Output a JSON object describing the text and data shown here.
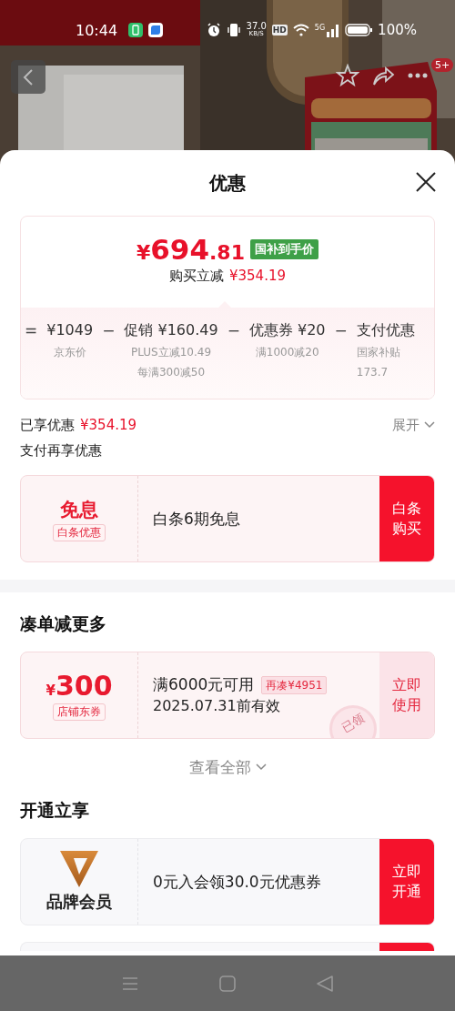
{
  "status_bar": {
    "time": "10:44",
    "net_speed": "37.0",
    "net_unit": "KB/S",
    "hd": "HD",
    "network": "5G",
    "battery": "100%"
  },
  "header": {
    "kind": "picture",
    "badge": "5+"
  },
  "sheet": {
    "title": "优惠"
  },
  "price_card": {
    "currency": "¥",
    "price_int": "694",
    "price_dec": ".81",
    "tag": "国补到手价",
    "saving_label": "购买立减",
    "saving_value": "¥354.19",
    "breakdown": [
      {
        "operator": "=",
        "amount": "¥1049",
        "notes": [
          "京东价"
        ]
      },
      {
        "operator": "−",
        "amount": "促销 ¥160.49",
        "notes": [
          "PLUS立减10.49",
          "每满300减50"
        ]
      },
      {
        "operator": "−",
        "amount": "优惠券 ¥20",
        "notes": [
          "满1000减20"
        ]
      },
      {
        "operator": "−",
        "amount": "支付优惠",
        "notes": [
          "国家补贴",
          "173.7"
        ]
      }
    ]
  },
  "enjoyed": {
    "label": "已享优惠",
    "value": "¥354.19",
    "toggle": "展开",
    "expanded": false
  },
  "pay_section": {
    "title": "支付再享优惠",
    "offers": [
      {
        "kind": "interest_free",
        "title": "免息",
        "tag": "白条优惠",
        "text": "白条6期免息",
        "button": "白条购买"
      }
    ]
  },
  "bundle_section": {
    "title": "凑单减更多",
    "offers": [
      {
        "kind": "coupon",
        "currency": "¥",
        "amount": "300",
        "tag": "店铺东券",
        "condition": "满6000元可用",
        "extra": "再凑¥4951",
        "validity": "2025.07.31前有效",
        "button": "立即使用",
        "claimed": true,
        "stamp": "已领"
      }
    ],
    "more": "查看全部"
  },
  "member_section": {
    "title": "开通立享",
    "offers": [
      {
        "kind": "membership",
        "title": "品牌会员",
        "text": "0元入会领30.0元优惠券",
        "button": "立即开通"
      },
      {
        "kind": "cut_off"
      }
    ]
  }
}
